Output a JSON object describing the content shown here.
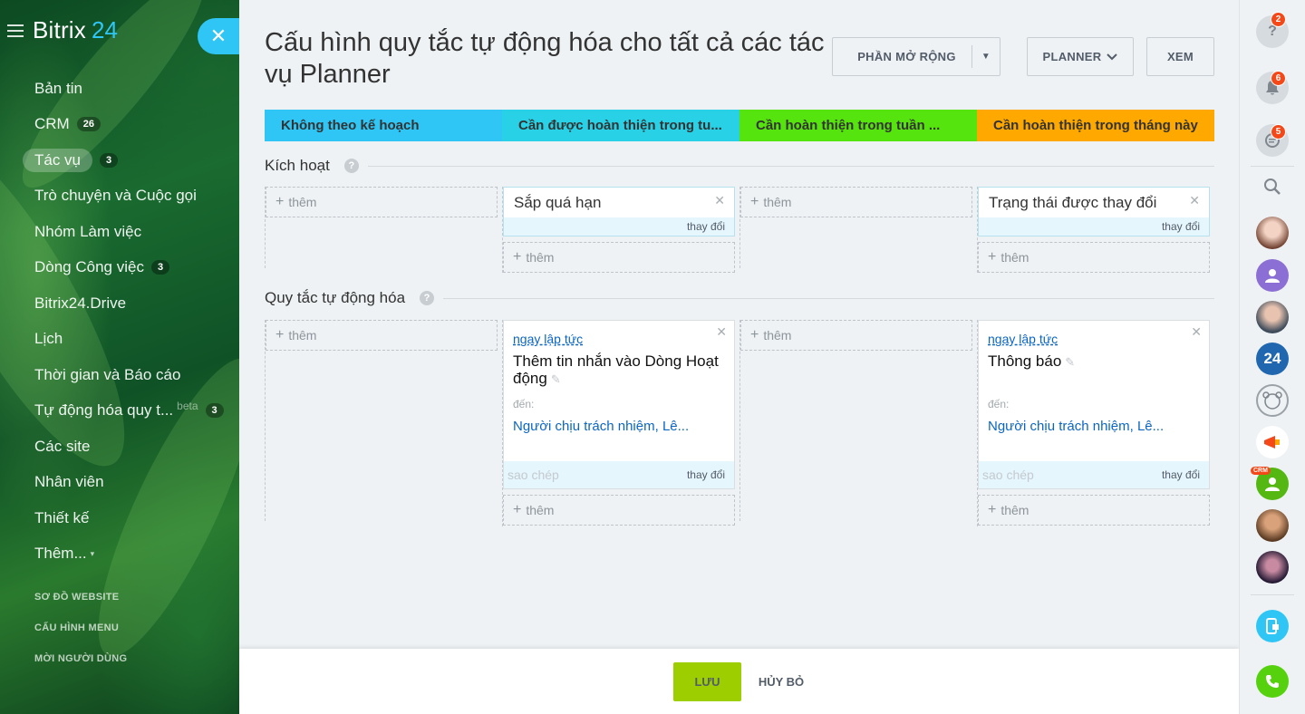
{
  "sidebar": {
    "brand_name": "Bitrix",
    "brand_num": "24",
    "items": [
      {
        "label": "Bản tin",
        "counter": ""
      },
      {
        "label": "CRM",
        "counter": "26"
      },
      {
        "label": "Tác vụ",
        "counter": "3",
        "active": true
      },
      {
        "label": "Trò chuyện và Cuộc gọi",
        "counter": ""
      },
      {
        "label": "Nhóm Làm việc",
        "counter": ""
      },
      {
        "label": "Dòng Công việc",
        "counter": "3"
      },
      {
        "label": "Bitrix24.Drive",
        "counter": ""
      },
      {
        "label": "Lịch",
        "counter": ""
      },
      {
        "label": "Thời gian và Báo cáo",
        "counter": ""
      },
      {
        "label": "Tự động hóa quy t...",
        "counter": "3",
        "beta": "beta"
      },
      {
        "label": "Các site",
        "counter": ""
      },
      {
        "label": "Nhân viên",
        "counter": ""
      },
      {
        "label": "Thiết kế",
        "counter": ""
      },
      {
        "label": "Thêm...",
        "counter": ""
      }
    ],
    "footer_links": [
      "SƠ ĐỒ WEBSITE",
      "CẤU HÌNH MENU",
      "MỜI NGƯỜI DÙNG"
    ]
  },
  "header": {
    "title": "Cấu hình quy tắc tự động hóa cho tất cả các tác vụ Planner",
    "extensions_label": "PHẦN MỞ RỘNG",
    "planner_label": "PLANNER",
    "view_label": "XEM"
  },
  "stages": [
    {
      "label": "Không theo kế hoạch",
      "color": "#2fc6f6"
    },
    {
      "label": "Cần được hoàn thiện trong tu...",
      "color": "#28d1e6"
    },
    {
      "label": "Cần hoàn thiện trong tuần ...",
      "color": "#55e40d"
    },
    {
      "label": "Cần hoàn thiện trong tháng này",
      "color": "#ffa900"
    }
  ],
  "triggers_section": {
    "title": "Kích hoạt",
    "add_label": "thêm",
    "cards": [
      {
        "name": "Sắp quá hạn",
        "change": "thay đổi"
      },
      {
        "name": "Trạng thái được thay đổi",
        "change": "thay đổi"
      }
    ]
  },
  "rules_section": {
    "title": "Quy tắc tự động hóa",
    "add_label": "thêm",
    "cards": [
      {
        "when": "ngay lập tức",
        "title": "Thêm tin nhắn vào Dòng Hoạt động",
        "to_label": "đến:",
        "recipients": "Người chịu trách nhiệm, Lê...",
        "copy": "sao chép",
        "change": "thay đổi"
      },
      {
        "when": "ngay lập tức",
        "title": "Thông báo",
        "to_label": "đến:",
        "recipients": "Người chịu trách nhiệm, Lê...",
        "copy": "sao chép",
        "change": "thay đổi"
      }
    ]
  },
  "footer": {
    "save_label": "LƯU",
    "cancel_label": "HỦY BỎ"
  },
  "rightbar": {
    "help_badge": "2",
    "notifications_badge": "6",
    "chat_badge": "5",
    "crm_label": "CRM",
    "bitrix_label": "24"
  },
  "colors": {
    "accent": "#2fc6f6",
    "save": "#9dcf00",
    "badge": "#f54819"
  }
}
